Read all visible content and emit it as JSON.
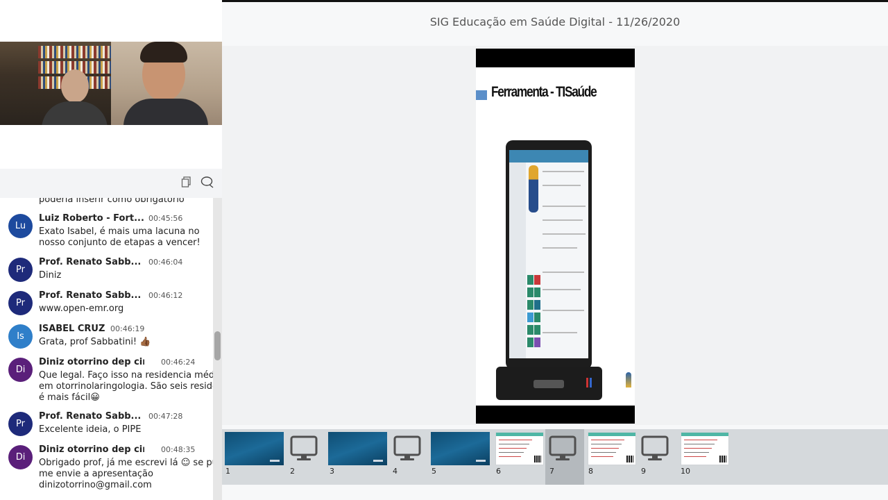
{
  "header": {
    "title": "SIG Educação em Saúde Digital - 11/26/2020"
  },
  "chat": {
    "copy_icon": "copy-icon",
    "chat_icon": "chat-bubble-icon",
    "partial_text": "poderia inserir como obrigatório",
    "messages": [
      {
        "initials": "Lu",
        "color": "#1d4a9e",
        "name": "Luiz Roberto - Fort...",
        "time": "00:45:56",
        "lines": [
          "Exato Isabel, é mais uma lacuna no",
          "nosso conjunto de  etapas a vencer!"
        ]
      },
      {
        "initials": "Pr",
        "color": "#1e2a7a",
        "name": "Prof. Renato Sabb...",
        "time": "00:46:04",
        "lines": [
          "Diniz"
        ]
      },
      {
        "initials": "Pr",
        "color": "#1e2a7a",
        "name": "Prof. Renato Sabb...",
        "time": "00:46:12",
        "lines": [
          "www.open-emr.org"
        ]
      },
      {
        "initials": "Is",
        "color": "#2f7fc9",
        "name": "ISABEL CRUZ",
        "time": "00:46:19",
        "lines": [
          "Grata, prof Sabbatini! 👍🏾"
        ]
      },
      {
        "initials": "Di",
        "color": "#5a1f7a",
        "name": "Diniz otorrino dep cir...",
        "time": "00:46:24",
        "lines": [
          "Que legal. Faço isso na residencia médica",
          "em otorrinolaringologia. São seis residentes",
          "é mais fácil😀"
        ]
      },
      {
        "initials": "Pr",
        "color": "#1e2a7a",
        "name": "Prof. Renato Sabb...",
        "time": "00:47:28",
        "lines": [
          "Excelente ideia, o PIPE"
        ]
      },
      {
        "initials": "Di",
        "color": "#5a1f7a",
        "name": "Diniz otorrino dep cir...",
        "time": "00:48:35",
        "lines": [
          "Obrigado prof, já me escrevi lá ☺ se puder",
          "me envie a apresentação",
          "dinizotorrino@gmail.com"
        ]
      }
    ]
  },
  "slide": {
    "heading": "Ferramenta - TISaúde"
  },
  "thumbnails": [
    {
      "num": "1",
      "kind": "blue"
    },
    {
      "num": "2",
      "kind": "monitor"
    },
    {
      "num": "3",
      "kind": "blue"
    },
    {
      "num": "4",
      "kind": "monitor"
    },
    {
      "num": "5",
      "kind": "blue"
    },
    {
      "num": "6",
      "kind": "white"
    },
    {
      "num": "7",
      "kind": "monitor",
      "selected": true
    },
    {
      "num": "8",
      "kind": "white"
    },
    {
      "num": "9",
      "kind": "monitor"
    },
    {
      "num": "10",
      "kind": "white"
    }
  ]
}
